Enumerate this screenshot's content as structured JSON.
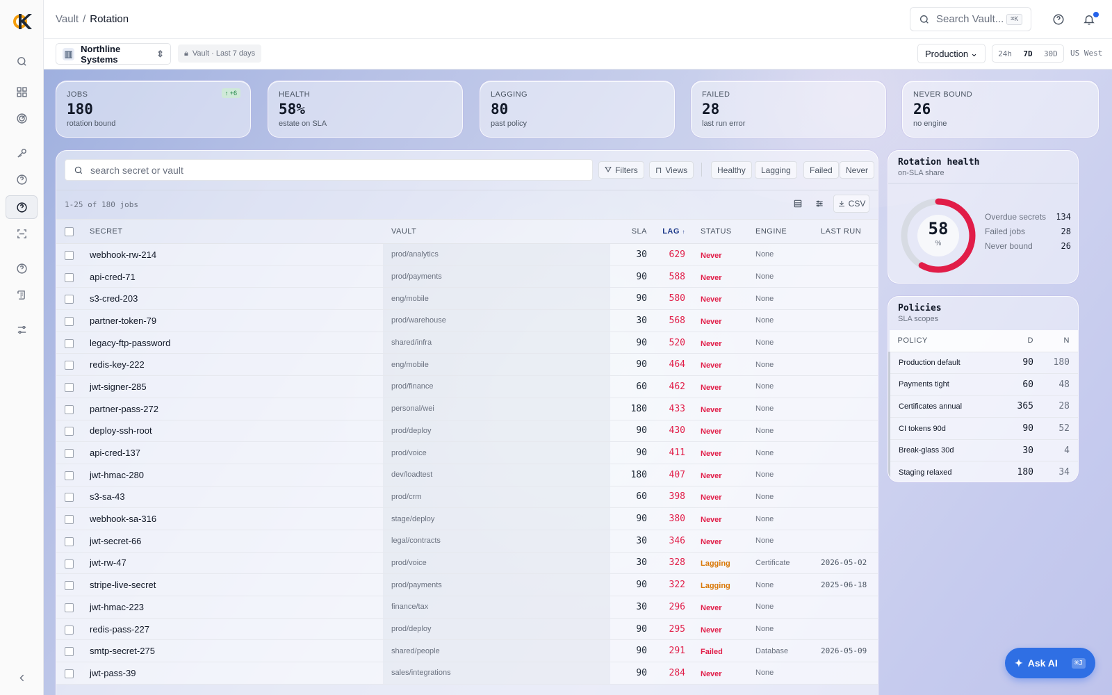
{
  "breadcrumb": {
    "root": "Vault",
    "sep": "/",
    "current": "Rotation"
  },
  "search": {
    "placeholder": "Search Vault...",
    "kbd": "⌘K"
  },
  "org": {
    "name": "Northline Systems"
  },
  "scope": {
    "label": "Vault · Last 7 days"
  },
  "env": {
    "selected": "Production"
  },
  "ranges": [
    "24h",
    "7D",
    "30D"
  ],
  "region": "US West",
  "stats": [
    {
      "label": "JOBS",
      "value": "180",
      "sub": "rotation bound",
      "delta": "↑ +6"
    },
    {
      "label": "HEALTH",
      "value": "58%",
      "sub": "estate on SLA"
    },
    {
      "label": "LAGGING",
      "value": "80",
      "sub": "past policy"
    },
    {
      "label": "FAILED",
      "value": "28",
      "sub": "last run error"
    },
    {
      "label": "NEVER BOUND",
      "value": "26",
      "sub": "no engine"
    }
  ],
  "table": {
    "search_placeholder": "search secret or vault",
    "filters": "Filters",
    "views": "Views",
    "quick_filters": [
      "Healthy",
      "Lagging",
      "Failed",
      "Never"
    ],
    "count": "1-25 of 180 jobs",
    "csv": "CSV",
    "headers": {
      "secret": "SECRET",
      "vault": "VAULT",
      "sla": "SLA",
      "lag": "LAG",
      "status": "STATUS",
      "engine": "ENGINE",
      "last_run": "LAST RUN"
    },
    "rows": [
      {
        "secret": "webhook-rw-214",
        "vault": "prod/analytics",
        "sla": "30",
        "lag": "629",
        "status": "Never",
        "engine": "None",
        "last_run": ""
      },
      {
        "secret": "api-cred-71",
        "vault": "prod/payments",
        "sla": "90",
        "lag": "588",
        "status": "Never",
        "engine": "None",
        "last_run": ""
      },
      {
        "secret": "s3-cred-203",
        "vault": "eng/mobile",
        "sla": "90",
        "lag": "580",
        "status": "Never",
        "engine": "None",
        "last_run": ""
      },
      {
        "secret": "partner-token-79",
        "vault": "prod/warehouse",
        "sla": "30",
        "lag": "568",
        "status": "Never",
        "engine": "None",
        "last_run": ""
      },
      {
        "secret": "legacy-ftp-password",
        "vault": "shared/infra",
        "sla": "90",
        "lag": "520",
        "status": "Never",
        "engine": "None",
        "last_run": ""
      },
      {
        "secret": "redis-key-222",
        "vault": "eng/mobile",
        "sla": "90",
        "lag": "464",
        "status": "Never",
        "engine": "None",
        "last_run": ""
      },
      {
        "secret": "jwt-signer-285",
        "vault": "prod/finance",
        "sla": "60",
        "lag": "462",
        "status": "Never",
        "engine": "None",
        "last_run": ""
      },
      {
        "secret": "partner-pass-272",
        "vault": "personal/wei",
        "sla": "180",
        "lag": "433",
        "status": "Never",
        "engine": "None",
        "last_run": ""
      },
      {
        "secret": "deploy-ssh-root",
        "vault": "prod/deploy",
        "sla": "90",
        "lag": "430",
        "status": "Never",
        "engine": "None",
        "last_run": ""
      },
      {
        "secret": "api-cred-137",
        "vault": "prod/voice",
        "sla": "90",
        "lag": "411",
        "status": "Never",
        "engine": "None",
        "last_run": ""
      },
      {
        "secret": "jwt-hmac-280",
        "vault": "dev/loadtest",
        "sla": "180",
        "lag": "407",
        "status": "Never",
        "engine": "None",
        "last_run": ""
      },
      {
        "secret": "s3-sa-43",
        "vault": "prod/crm",
        "sla": "60",
        "lag": "398",
        "status": "Never",
        "engine": "None",
        "last_run": ""
      },
      {
        "secret": "webhook-sa-316",
        "vault": "stage/deploy",
        "sla": "90",
        "lag": "380",
        "status": "Never",
        "engine": "None",
        "last_run": ""
      },
      {
        "secret": "jwt-secret-66",
        "vault": "legal/contracts",
        "sla": "30",
        "lag": "346",
        "status": "Never",
        "engine": "None",
        "last_run": ""
      },
      {
        "secret": "jwt-rw-47",
        "vault": "prod/voice",
        "sla": "30",
        "lag": "328",
        "status": "Lagging",
        "engine": "Certificate",
        "last_run": "2026-05-02"
      },
      {
        "secret": "stripe-live-secret",
        "vault": "prod/payments",
        "sla": "90",
        "lag": "322",
        "status": "Lagging",
        "engine": "None",
        "last_run": "2025-06-18"
      },
      {
        "secret": "jwt-hmac-223",
        "vault": "finance/tax",
        "sla": "30",
        "lag": "296",
        "status": "Never",
        "engine": "None",
        "last_run": ""
      },
      {
        "secret": "redis-pass-227",
        "vault": "prod/deploy",
        "sla": "90",
        "lag": "295",
        "status": "Never",
        "engine": "None",
        "last_run": ""
      },
      {
        "secret": "smtp-secret-275",
        "vault": "shared/people",
        "sla": "90",
        "lag": "291",
        "status": "Failed",
        "engine": "Database",
        "last_run": "2026-05-09"
      },
      {
        "secret": "jwt-pass-39",
        "vault": "sales/integrations",
        "sla": "90",
        "lag": "284",
        "status": "Never",
        "engine": "None",
        "last_run": ""
      }
    ]
  },
  "health": {
    "title": "Rotation health",
    "subtitle": "on-SLA share",
    "value": "58",
    "pct_label": "%",
    "fraction": 0.58,
    "items": [
      {
        "label": "Overdue secrets",
        "value": "134"
      },
      {
        "label": "Failed jobs",
        "value": "28"
      },
      {
        "label": "Never bound",
        "value": "26"
      }
    ]
  },
  "policies": {
    "title": "Policies",
    "subtitle": "SLA scopes",
    "headers": {
      "policy": "POLICY",
      "d": "D",
      "n": "N"
    },
    "rows": [
      {
        "name": "Production default",
        "d": "90",
        "n": "180"
      },
      {
        "name": "Payments tight",
        "d": "60",
        "n": "48"
      },
      {
        "name": "Certificates annual",
        "d": "365",
        "n": "28"
      },
      {
        "name": "CI tokens 90d",
        "d": "90",
        "n": "52"
      },
      {
        "name": "Break-glass 30d",
        "d": "30",
        "n": "4"
      },
      {
        "name": "Staging relaxed",
        "d": "180",
        "n": "34"
      }
    ]
  },
  "ask_ai": {
    "label": "Ask AI",
    "kbd": "⌘J"
  },
  "colors": {
    "accent": "#2f6fe4",
    "danger": "#e11d48",
    "warning": "#d97706",
    "gauge": "#e11d48"
  }
}
